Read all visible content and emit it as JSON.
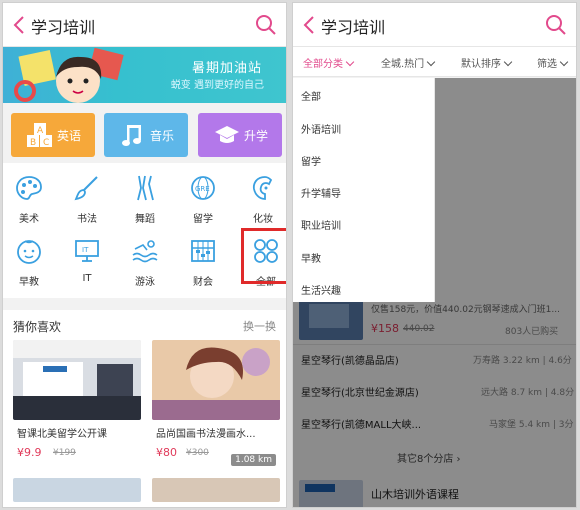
{
  "left": {
    "header": {
      "title": "学习培训"
    },
    "banner": {
      "title": "暑期加油站",
      "subtitle": "蜕变 遇到更好的自己"
    },
    "tiles": [
      {
        "label": "英语",
        "color": "#f6a83a"
      },
      {
        "label": "音乐",
        "color": "#5eb7e9"
      },
      {
        "label": "升学",
        "color": "#b378ea"
      }
    ],
    "categories": [
      {
        "label": "美术",
        "icon": "palette-icon"
      },
      {
        "label": "书法",
        "icon": "brush-icon"
      },
      {
        "label": "舞蹈",
        "icon": "dance-icon"
      },
      {
        "label": "留学",
        "icon": "gre-globe-icon"
      },
      {
        "label": "化妆",
        "icon": "makeup-icon"
      },
      {
        "label": "早教",
        "icon": "baby-icon"
      },
      {
        "label": "IT",
        "icon": "monitor-icon"
      },
      {
        "label": "游泳",
        "icon": "swim-icon"
      },
      {
        "label": "财会",
        "icon": "abacus-icon"
      },
      {
        "label": "全部",
        "icon": "grid-icon"
      }
    ],
    "guess": {
      "title": "猜你喜欢",
      "more": "换一换",
      "cards": [
        {
          "name": "智课北美留学公开课",
          "price": "¥9.9",
          "original": "¥199"
        },
        {
          "name": "品尚国画书法漫画水...",
          "price": "¥80",
          "original": "¥300",
          "distance": "1.08 km"
        }
      ]
    }
  },
  "right": {
    "header": {
      "title": "学习培训"
    },
    "filters": [
      "全部分类",
      "全城.热门",
      "默认排序",
      "筛选"
    ],
    "menu": [
      "全部",
      "外语培训",
      "留学",
      "升学辅导",
      "职业培训",
      "早教",
      "生活兴趣"
    ],
    "list": {
      "row1_note": "仅售158元，价值440.02元钢琴速成入门班1...",
      "row1_price": "¥158",
      "row1_orig": "440.02",
      "row1_sold": "803人已购买",
      "branches": [
        {
          "name": "星空琴行(凯德晶品店)",
          "meta": "万寿路 3.22 km | 4.6分"
        },
        {
          "name": "星空琴行(北京世纪金源店)",
          "meta": "远大路 8.7 km | 4.8分"
        },
        {
          "name": "星空琴行(凯德MALL大峡...",
          "meta": "马家堡 5.4 km | 3分"
        }
      ],
      "more_branches": "其它8个分店",
      "last_title": "山木培训外语课程"
    }
  },
  "colors": {
    "accent": "#e24a8c",
    "highlight": "#e02a2a",
    "price": "#e03a5a"
  }
}
